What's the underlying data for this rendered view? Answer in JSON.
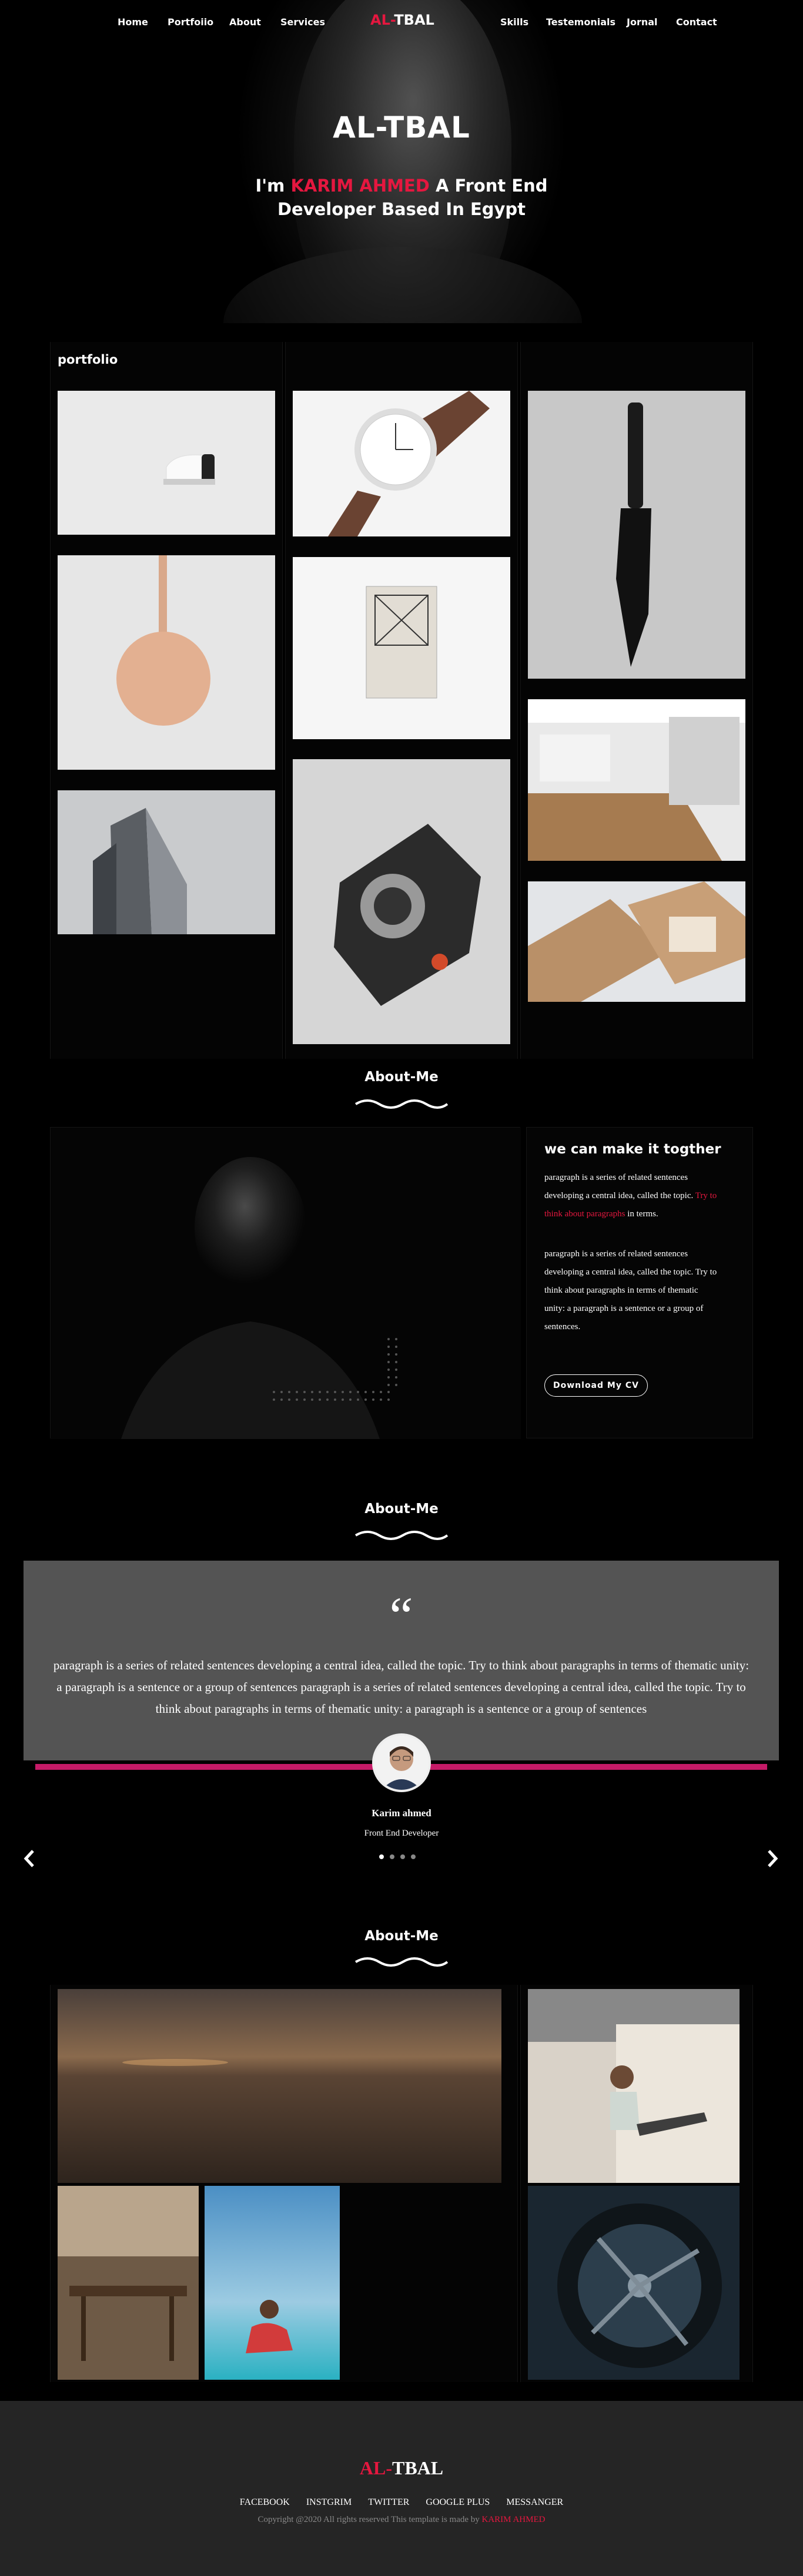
{
  "nav": {
    "left": [
      "Home",
      "Portfoiio",
      "About",
      "Services"
    ],
    "right": [
      "Skills",
      "Testemonials",
      "Jornal",
      "Contact"
    ],
    "logo_red": "AL-",
    "logo_white": "TBAL"
  },
  "hero": {
    "title": "AL-TBAL",
    "subtitle_pre": "I'm ",
    "subtitle_name": "KARIM AHMED",
    "subtitle_post": " A Front End Developer Based In Egypt"
  },
  "portfolio": {
    "title": "portfolio"
  },
  "about": {
    "heading": "About-Me",
    "right_title": "we can make it togther",
    "p1_pre": "paragraph is a series of related sentences developing a central idea, called the topic. ",
    "p1_red": "Try to think about paragraphs",
    "p1_post": " in terms.",
    "p2": "paragraph is a series of related sentences developing a central idea, called the topic. Try to think about paragraphs in terms of thematic unity: a paragraph is a sentence or a group of sentences.",
    "cv_button": "Download My CV"
  },
  "testimonial": {
    "heading": "About-Me",
    "quote_mark": "“",
    "text": "paragraph is a series of related sentences developing a central idea, called the topic. Try to think about paragraphs in terms of thematic unity: a paragraph is a sentence or a group of sentences paragraph is a series of related sentences developing a central idea, called the topic. Try to think about paragraphs in terms of thematic unity: a paragraph is a sentence or a group of sentences",
    "name": "Karim ahmed",
    "role": "Front End Developer",
    "active_dot": 0,
    "dot_count": 4
  },
  "gallery": {
    "heading": "About-Me"
  },
  "footer": {
    "logo_red": "AL-",
    "logo_white": "TBAL",
    "links": [
      "FACEBOOK",
      "INSTGRIM",
      "TWITTER",
      "GOOGLE PLUS",
      "MESSANGER"
    ],
    "copy_pre": "Copyright @2020 All rights reserved This template is made by ",
    "copy_name": "KARIM AHMED"
  },
  "colors": {
    "accent": "#e5173f",
    "bar": "#c51a67",
    "card": "#545454",
    "footer": "#252525"
  }
}
